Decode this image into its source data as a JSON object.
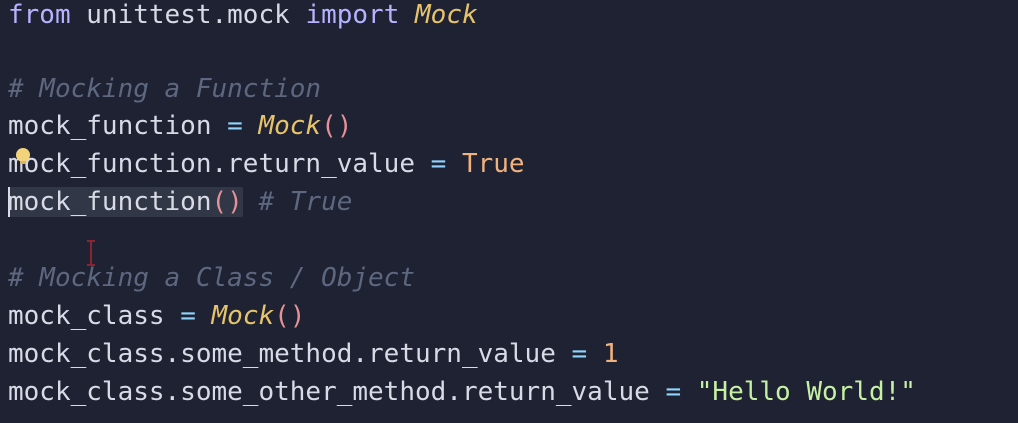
{
  "editor": {
    "line1": {
      "kw_from": "from",
      "module": " unittest.mock ",
      "kw_import": "import",
      "space": " ",
      "cls": "Mock"
    },
    "line2": {
      "comment": "# Mocking a Function"
    },
    "line3": {
      "name": "mock_function",
      "eq": " = ",
      "cls": "Mock",
      "parens": "()"
    },
    "line4": {
      "name": "mock_function.return_value",
      "eq": " = ",
      "value": "True"
    },
    "line5": {
      "name": "mock_function",
      "parens": "()",
      "comment": " # True"
    },
    "line6": {
      "comment": "# Mocking a Class / Object"
    },
    "line7": {
      "name": "mock_class",
      "eq": " = ",
      "cls": "Mock",
      "parens": "()"
    },
    "line8": {
      "name": "mock_class.some_method.return_value",
      "eq": " = ",
      "value": "1"
    },
    "line9": {
      "name": "mock_class.some_other_method.return_value",
      "eq": " = ",
      "value": "\"Hello World!\""
    }
  }
}
